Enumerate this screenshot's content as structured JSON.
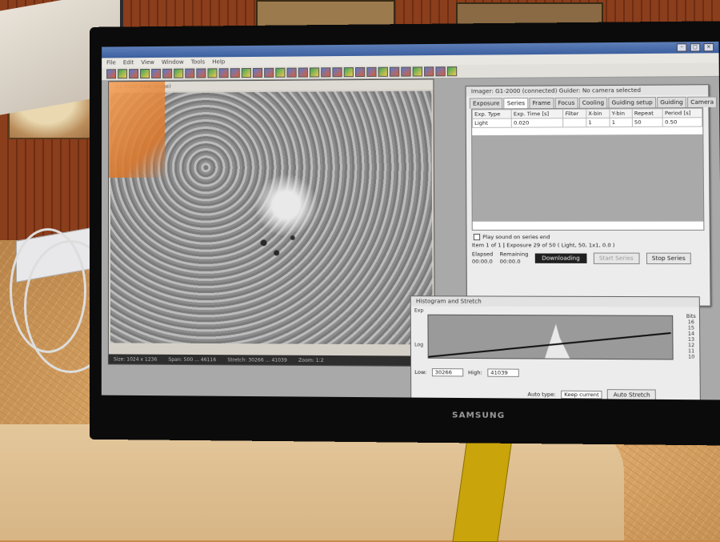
{
  "monitor": {
    "brand": "SAMSUNG"
  },
  "app": {
    "menu": [
      "File",
      "Edit",
      "View",
      "Window",
      "Tools",
      "Help"
    ],
    "image_window_title": "G1-2000 (raw image)",
    "status": {
      "size": "Size: 1024 x 1236",
      "span": "Span: 500 ... 46116",
      "stretch": "Stretch: 30266 ... 41039",
      "zoom": "Zoom: 1:2"
    }
  },
  "imager": {
    "title": "Imager: G1-2000 (connected)  Guider: No camera selected",
    "tabs": [
      "Exposure",
      "Series",
      "Frame",
      "Focus",
      "Cooling",
      "Guiding setup",
      "Guiding",
      "Camera"
    ],
    "active_tab": "Series",
    "columns": [
      "Exp. Type",
      "Exp. Time [s]",
      "Filter",
      "X-bin",
      "Y-bin",
      "Repeat",
      "Period [s]"
    ],
    "rows": [
      [
        "Light",
        "0.020",
        "",
        "1",
        "1",
        "50",
        "0.50"
      ]
    ],
    "play_sound_label": "Play sound on series end",
    "item_info": "Item 1 of 1  |  Exposure 29 of 50  ( Light, 50, 1x1, 0.0 )",
    "elapsed_label": "Elapsed",
    "elapsed_value": "00:00.0",
    "remaining_label": "Remaining",
    "remaining_value": "00:00.0",
    "downloading": "Downloading",
    "start_series": "Start Series",
    "stop_series": "Stop Series"
  },
  "histogram": {
    "title": "Histogram and Stretch",
    "exp_label": "Exp",
    "log_label": "Log",
    "bits_label": "Bits",
    "bits": [
      "16",
      "15",
      "14",
      "13",
      "12",
      "11",
      "10"
    ],
    "low_label": "Low:",
    "low_value": "30266",
    "high_label": "High:",
    "high_value": "41039",
    "auto_type_label": "Auto type:",
    "auto_type_value": "Keep current",
    "auto_stretch": "Auto Stretch"
  }
}
